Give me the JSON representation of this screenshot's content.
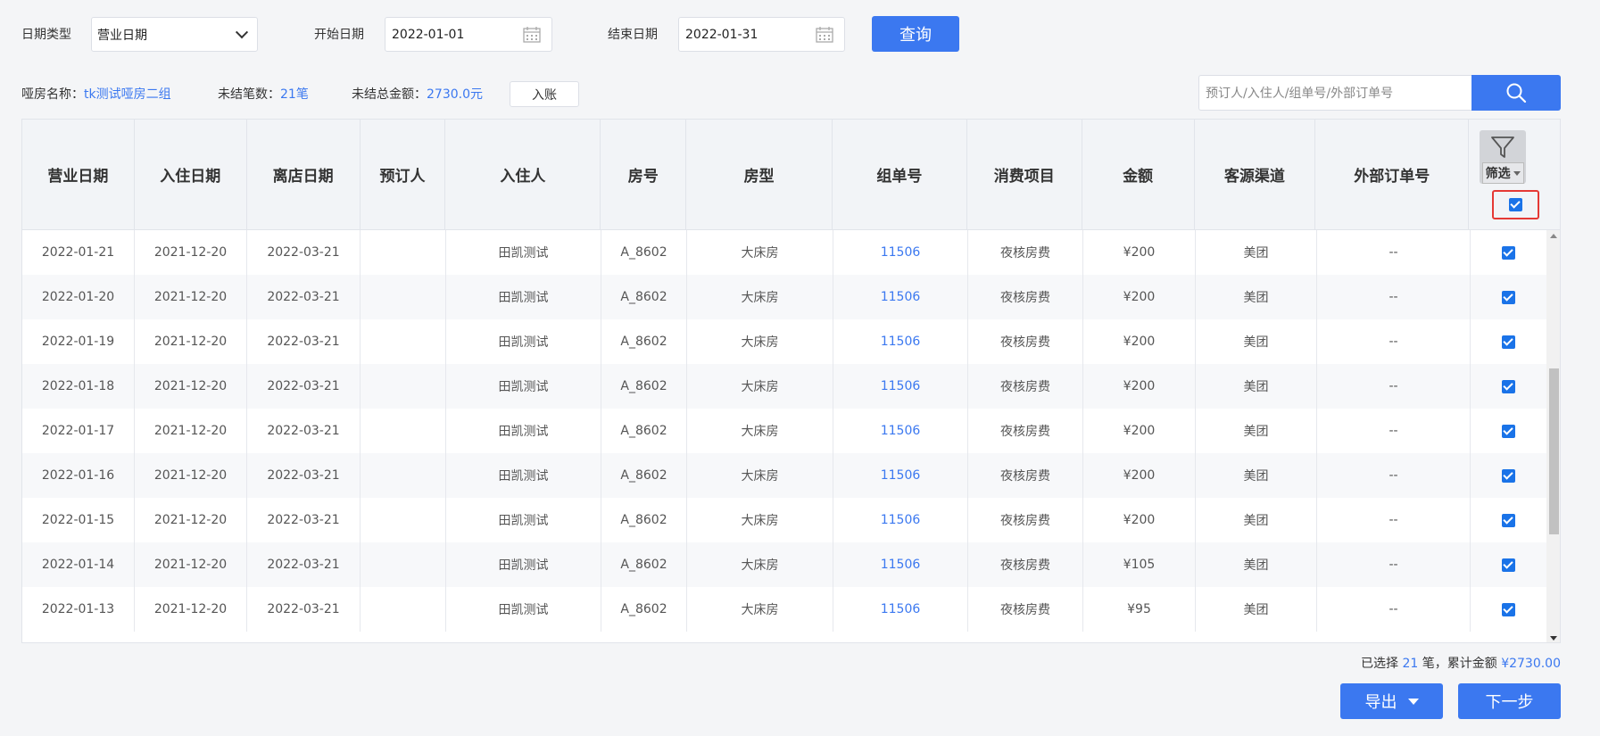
{
  "filters": {
    "date_type_label": "日期类型",
    "date_type_value": "营业日期",
    "start_label": "开始日期",
    "start_value": "2022-01-01",
    "end_label": "结束日期",
    "end_value": "2022-01-31",
    "query_label": "查询"
  },
  "info": {
    "room_name_label": "哑房名称：",
    "room_name_value": "tk测试哑房二组",
    "unsettled_count_label": "未结笔数：",
    "unsettled_count_value": "21笔",
    "unsettled_total_label": "未结总金额：",
    "unsettled_total_value": "2730.0元",
    "post_label": "入账"
  },
  "search": {
    "placeholder": "预订人/入住人/组单号/外部订单号"
  },
  "table": {
    "headers": [
      "营业日期",
      "入住日期",
      "离店日期",
      "预订人",
      "入住人",
      "房号",
      "房型",
      "组单号",
      "消费项目",
      "金额",
      "客源渠道",
      "外部订单号"
    ],
    "filter_label": "筛选",
    "rows": [
      [
        "2022-01-21",
        "2021-12-20",
        "2022-03-21",
        "",
        "田凯测试",
        "A_8602",
        "大床房",
        "11506",
        "夜核房费",
        "¥200",
        "美团",
        "--"
      ],
      [
        "2022-01-20",
        "2021-12-20",
        "2022-03-21",
        "",
        "田凯测试",
        "A_8602",
        "大床房",
        "11506",
        "夜核房费",
        "¥200",
        "美团",
        "--"
      ],
      [
        "2022-01-19",
        "2021-12-20",
        "2022-03-21",
        "",
        "田凯测试",
        "A_8602",
        "大床房",
        "11506",
        "夜核房费",
        "¥200",
        "美团",
        "--"
      ],
      [
        "2022-01-18",
        "2021-12-20",
        "2022-03-21",
        "",
        "田凯测试",
        "A_8602",
        "大床房",
        "11506",
        "夜核房费",
        "¥200",
        "美团",
        "--"
      ],
      [
        "2022-01-17",
        "2021-12-20",
        "2022-03-21",
        "",
        "田凯测试",
        "A_8602",
        "大床房",
        "11506",
        "夜核房费",
        "¥200",
        "美团",
        "--"
      ],
      [
        "2022-01-16",
        "2021-12-20",
        "2022-03-21",
        "",
        "田凯测试",
        "A_8602",
        "大床房",
        "11506",
        "夜核房费",
        "¥200",
        "美团",
        "--"
      ],
      [
        "2022-01-15",
        "2021-12-20",
        "2022-03-21",
        "",
        "田凯测试",
        "A_8602",
        "大床房",
        "11506",
        "夜核房费",
        "¥200",
        "美团",
        "--"
      ],
      [
        "2022-01-14",
        "2021-12-20",
        "2022-03-21",
        "",
        "田凯测试",
        "A_8602",
        "大床房",
        "11506",
        "夜核房费",
        "¥105",
        "美团",
        "--"
      ],
      [
        "2022-01-13",
        "2021-12-20",
        "2022-03-21",
        "",
        "田凯测试",
        "A_8602",
        "大床房",
        "11506",
        "夜核房费",
        "¥95",
        "美团",
        "--"
      ]
    ]
  },
  "summary": {
    "prefix": "已选择",
    "count": "21",
    "mid": "笔，累计金额",
    "amount": "¥2730.00"
  },
  "actions": {
    "export_label": "导出",
    "next_label": "下一步"
  },
  "colors": {
    "primary": "#3b78f0",
    "highlight": "#e53935"
  }
}
